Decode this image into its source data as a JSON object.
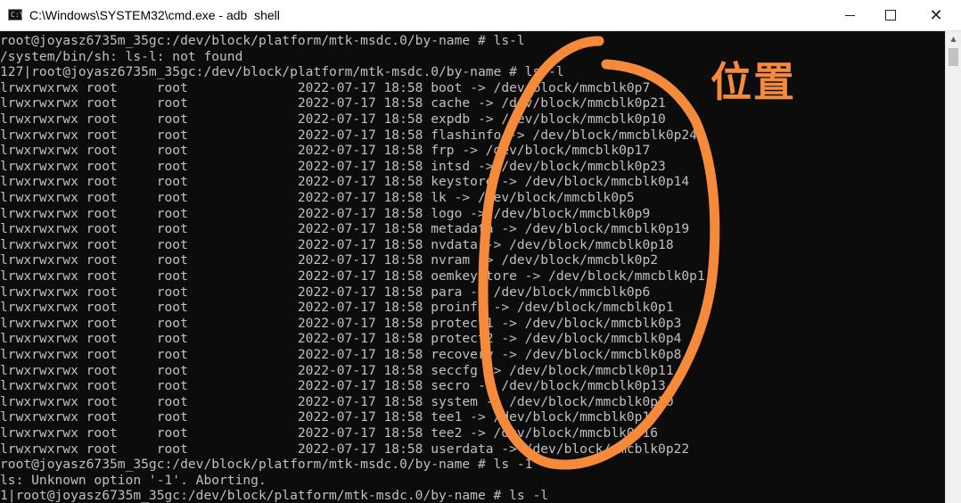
{
  "window": {
    "title": "C:\\Windows\\SYSTEM32\\cmd.exe - adb  shell",
    "minimize_glyph": "",
    "maximize_glyph": "",
    "close_glyph": "✕",
    "icon": "cmd-icon",
    "icon_text": "C:\\"
  },
  "console": {
    "lines": [
      "root@joyasz6735m_35gc:/dev/block/platform/mtk-msdc.0/by-name # ls-l",
      "/system/bin/sh: ls-l: not found",
      "127|root@joyasz6735m_35gc:/dev/block/platform/mtk-msdc.0/by-name # ls -l",
      "lrwxrwxrwx root     root              2022-07-17 18:58 boot -> /dev/block/mmcblk0p7",
      "lrwxrwxrwx root     root              2022-07-17 18:58 cache -> /dev/block/mmcblk0p21",
      "lrwxrwxrwx root     root              2022-07-17 18:58 expdb -> /dev/block/mmcblk0p10",
      "lrwxrwxrwx root     root              2022-07-17 18:58 flashinfo -> /dev/block/mmcblk0p24",
      "lrwxrwxrwx root     root              2022-07-17 18:58 frp -> /dev/block/mmcblk0p17",
      "lrwxrwxrwx root     root              2022-07-17 18:58 intsd -> /dev/block/mmcblk0p23",
      "lrwxrwxrwx root     root              2022-07-17 18:58 keystore -> /dev/block/mmcblk0p14",
      "lrwxrwxrwx root     root              2022-07-17 18:58 lk -> /dev/block/mmcblk0p5",
      "lrwxrwxrwx root     root              2022-07-17 18:58 logo -> /dev/block/mmcblk0p9",
      "lrwxrwxrwx root     root              2022-07-17 18:58 metadata -> /dev/block/mmcblk0p19",
      "lrwxrwxrwx root     root              2022-07-17 18:58 nvdata -> /dev/block/mmcblk0p18",
      "lrwxrwxrwx root     root              2022-07-17 18:58 nvram -> /dev/block/mmcblk0p2",
      "lrwxrwxrwx root     root              2022-07-17 18:58 oemkeystore -> /dev/block/mmcblk0p1",
      "lrwxrwxrwx root     root              2022-07-17 18:58 para -> /dev/block/mmcblk0p6",
      "lrwxrwxrwx root     root              2022-07-17 18:58 proinfo -> /dev/block/mmcblk0p1",
      "lrwxrwxrwx root     root              2022-07-17 18:58 protect1 -> /dev/block/mmcblk0p3",
      "lrwxrwxrwx root     root              2022-07-17 18:58 protect2 -> /dev/block/mmcblk0p4",
      "lrwxrwxrwx root     root              2022-07-17 18:58 recovery -> /dev/block/mmcblk0p8",
      "lrwxrwxrwx root     root              2022-07-17 18:58 seccfg -> /dev/block/mmcblk0p11",
      "lrwxrwxrwx root     root              2022-07-17 18:58 secro -> /dev/block/mmcblk0p13",
      "lrwxrwxrwx root     root              2022-07-17 18:58 system -> /dev/block/mmcblk0p20",
      "lrwxrwxrwx root     root              2022-07-17 18:58 tee1 -> /dev/block/mmcblk0p15",
      "lrwxrwxrwx root     root              2022-07-17 18:58 tee2 -> /dev/block/mmcblk0p16",
      "lrwxrwxrwx root     root              2022-07-17 18:58 userdata -> /dev/block/mmcblk0p22",
      "root@joyasz6735m_35gc:/dev/block/platform/mtk-msdc.0/by-name # ls -1",
      "ls: Unknown option '-1'. Aborting.",
      "1|root@joyasz6735m_35gc:/dev/block/platform/mtk-msdc.0/by-name # ls -l"
    ]
  },
  "scrollbar": {
    "up_glyph": "▲",
    "position": 0.0
  },
  "annotation": {
    "label": "位置",
    "color": "#f58a3a"
  }
}
